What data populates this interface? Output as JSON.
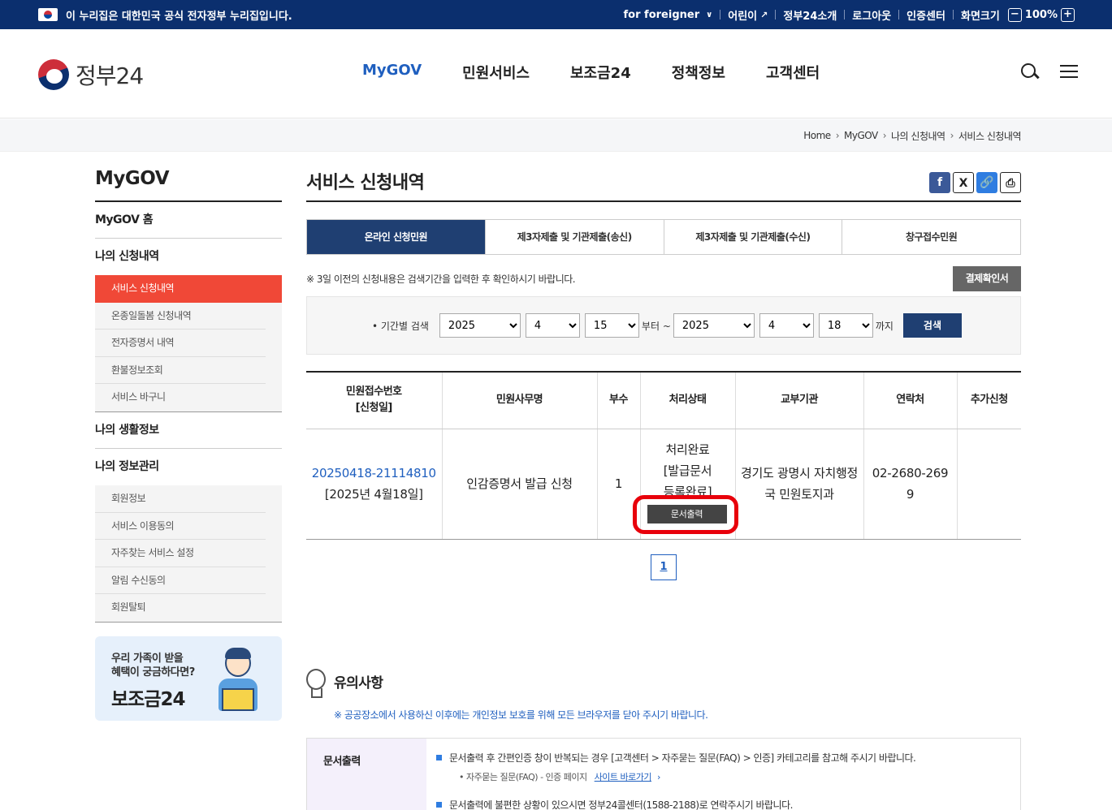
{
  "topbar": {
    "notice": "이 누리집은 대한민국 공식 전자정부 누리집입니다.",
    "links": [
      "for foreigner",
      "어린이",
      "정부24소개",
      "로그아웃",
      "인증센터",
      "화면크기"
    ],
    "zoom": "100%",
    "zoom_minus": "−",
    "zoom_plus": "+"
  },
  "header": {
    "logo": "정부24",
    "nav": [
      "MyGOV",
      "민원서비스",
      "보조금24",
      "정책정보",
      "고객센터"
    ]
  },
  "breadcrumb": [
    "Home",
    "MyGOV",
    "나의 신청내역",
    "서비스 신청내역"
  ],
  "lnb": {
    "title": "MyGOV",
    "home": "MyGOV 홈",
    "group1": "나의 신청내역",
    "group1_items": [
      "서비스 신청내역",
      "온종일돌봄 신청내역",
      "전자증명서 내역",
      "환불정보조회",
      "서비스 바구니"
    ],
    "group2": "나의 생활정보",
    "group3": "나의 정보관리",
    "group3_items": [
      "회원정보",
      "서비스 이용동의",
      "자주찾는 서비스 설정",
      "알림 수신동의",
      "회원탈퇴"
    ]
  },
  "banner": {
    "line1": "우리 가족이 받을",
    "line2": "혜택이 궁금하다면?",
    "title": "보조금24"
  },
  "content": {
    "title": "서비스 신청내역",
    "share": {
      "fb": "f",
      "x": "X",
      "link": "🔗",
      "print": "⎙"
    },
    "tabs": [
      "온라인 신청민원",
      "제3자제출 및 기관제출(송신)",
      "제3자제출 및 기관제출(수신)",
      "창구접수민원"
    ],
    "notice": "※ 3일 이전의 신청내용은 검색기간을 입력한 후 확인하시기 바랍니다.",
    "receipt_button": "결제확인서",
    "search": {
      "label": "• 기간별 검색",
      "from_year": "2025",
      "from_month": "4",
      "from_day": "15",
      "from_suffix": "부터 ~",
      "to_year": "2025",
      "to_month": "4",
      "to_day": "18",
      "to_suffix": "까지",
      "button": "검색"
    },
    "table": {
      "headers": [
        "민원접수번호",
        "[신청일]",
        "민원사무명",
        "부수",
        "처리상태",
        "교부기관",
        "연락처",
        "추가신청"
      ],
      "row": {
        "number": "20250418-21114810",
        "date": "[2025년 4월18일]",
        "name": "인감증명서 발급 신청",
        "copies": "1",
        "status1": "처리완료",
        "status2": "[발급문서",
        "status3": "등록완료]",
        "print_button": "문서출력",
        "agency": "경기도 광명시 자치행정국 민원토지과",
        "contact": "02-2680-2699",
        "extra": ""
      }
    },
    "pager": "1"
  },
  "caution": {
    "title": "유의사항",
    "note": "※ 공공장소에서 사용하신 이후에는 개인정보 보호를 위해 모든 브라우저를 닫아 주시기 바랍니다.",
    "box_head": "문서출력",
    "line1": "문서출력 후 간편인증 창이 반복되는 경우 [고객센터 > 자주묻는 질문(FAQ) > 인증] 카테고리를 참고해 주시기 바랍니다.",
    "sub1": "• 자주묻는 질문(FAQ) - 인증 페이지",
    "sub1_link": "사이트 바로가기",
    "line2": "문서출력에 불편한 상황이 있으시면 정부24콜센터(1588-2188)로 연락주시기 바랍니다."
  }
}
